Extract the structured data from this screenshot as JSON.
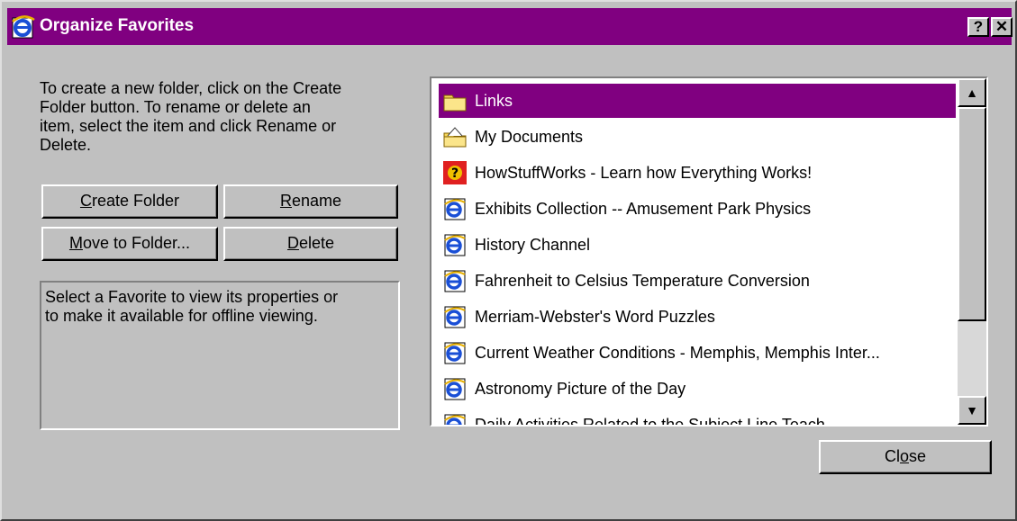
{
  "window": {
    "title": "Organize Favorites"
  },
  "titlebar": {
    "help_label": "?",
    "close_label": "✕"
  },
  "instructions": "To create a new folder, click on the Create\nFolder button. To rename or delete an\nitem, select the item and click Rename or\nDelete.",
  "buttons": {
    "create_folder": {
      "mnemonic": "C",
      "rest": "reate Folder"
    },
    "rename": {
      "mnemonic": "R",
      "rest": "ename"
    },
    "move_to_folder": {
      "mnemonic": "M",
      "rest": "ove to Folder..."
    },
    "delete": {
      "mnemonic": "D",
      "rest": "elete"
    },
    "close": {
      "pre": "Cl",
      "mnemonic": "o",
      "rest": "se"
    }
  },
  "properties_text": "Select a Favorite to view its properties or\nto make it available for offline viewing.",
  "favorites": [
    {
      "label": "Links",
      "icon": "folder-icon",
      "selected": true
    },
    {
      "label": "My Documents",
      "icon": "my-documents-folder-icon"
    },
    {
      "label": "HowStuffWorks - Learn how Everything Works!",
      "icon": "howstuffworks-icon"
    },
    {
      "label": "Exhibits Collection -- Amusement Park Physics",
      "icon": "ie-page-icon"
    },
    {
      "label": "History Channel",
      "icon": "ie-page-icon"
    },
    {
      "label": "Fahrenheit to Celsius Temperature Conversion",
      "icon": "ie-page-icon"
    },
    {
      "label": "Merriam-Webster's Word Puzzles",
      "icon": "ie-page-icon"
    },
    {
      "label": "Current Weather Conditions - Memphis, Memphis Inter...",
      "icon": "ie-page-icon"
    },
    {
      "label": "Astronomy Picture of the Day",
      "icon": "ie-page-icon"
    },
    {
      "label": "Daily Activities Related to the Subject Line Teach...",
      "icon": "ie-page-icon"
    }
  ],
  "scroll": {
    "position_fraction": 0.0
  },
  "colors": {
    "titlebar": "#800080",
    "selection": "#800080",
    "face": "#c0c0c0"
  }
}
